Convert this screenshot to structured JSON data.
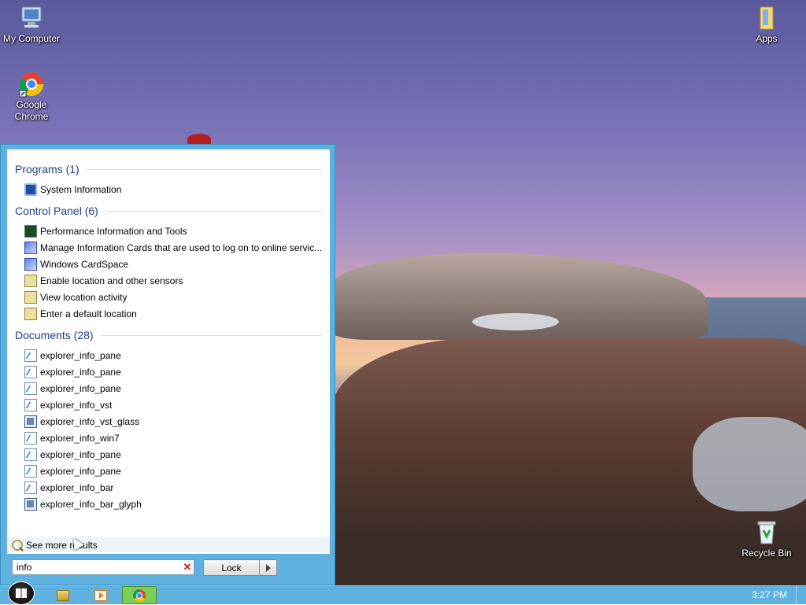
{
  "desktop": {
    "icons": [
      {
        "label": "My Computer",
        "icon": "computer-icon"
      },
      {
        "label": "Google Chrome",
        "icon": "chrome-icon"
      },
      {
        "label": "Apps",
        "icon": "folder-icon"
      },
      {
        "label": "Recycle Bin",
        "icon": "recycle-bin-icon"
      }
    ]
  },
  "start_menu": {
    "categories": [
      {
        "title": "Programs (1)",
        "items": [
          {
            "label": "System Information",
            "icon": "system-information-icon"
          }
        ]
      },
      {
        "title": "Control Panel (6)",
        "items": [
          {
            "label": "Performance Information and Tools",
            "icon": "performance-icon"
          },
          {
            "label": "Manage Information Cards that are used to log on to online servic...",
            "icon": "information-card-icon"
          },
          {
            "label": "Windows CardSpace",
            "icon": "cardspace-icon"
          },
          {
            "label": "Enable location and other sensors",
            "icon": "location-sensor-icon"
          },
          {
            "label": "View location activity",
            "icon": "location-sensor-icon"
          },
          {
            "label": "Enter a default location",
            "icon": "location-sensor-icon"
          }
        ]
      },
      {
        "title": "Documents (28)",
        "items": [
          {
            "label": "explorer_info_pane",
            "icon": "document-icon"
          },
          {
            "label": "explorer_info_pane",
            "icon": "document-icon"
          },
          {
            "label": "explorer_info_pane",
            "icon": "document-icon"
          },
          {
            "label": "explorer_info_vst",
            "icon": "document-icon"
          },
          {
            "label": "explorer_info_vst_glass",
            "icon": "image-document-icon"
          },
          {
            "label": "explorer_info_win7",
            "icon": "document-icon"
          },
          {
            "label": "explorer_info_pane",
            "icon": "document-icon"
          },
          {
            "label": "explorer_info_pane",
            "icon": "document-icon"
          },
          {
            "label": "explorer_info_bar",
            "icon": "document-icon"
          },
          {
            "label": "explorer_info_bar_glyph",
            "icon": "image-document-icon"
          }
        ]
      }
    ],
    "see_more": "See more results",
    "search": {
      "value": "info",
      "clear_icon": "close-icon"
    },
    "lock_button": "Lock"
  },
  "taskbar": {
    "pinned": [
      {
        "name": "windows-explorer",
        "icon": "folder-icon"
      },
      {
        "name": "media-player",
        "icon": "media-player-icon"
      },
      {
        "name": "google-chrome",
        "icon": "chrome-icon",
        "active": true
      }
    ],
    "clock": "3:27 PM"
  },
  "colors": {
    "taskbar": "#5fb2df",
    "category_text": "#1e3d8f",
    "active_task": "#7ccd55"
  }
}
